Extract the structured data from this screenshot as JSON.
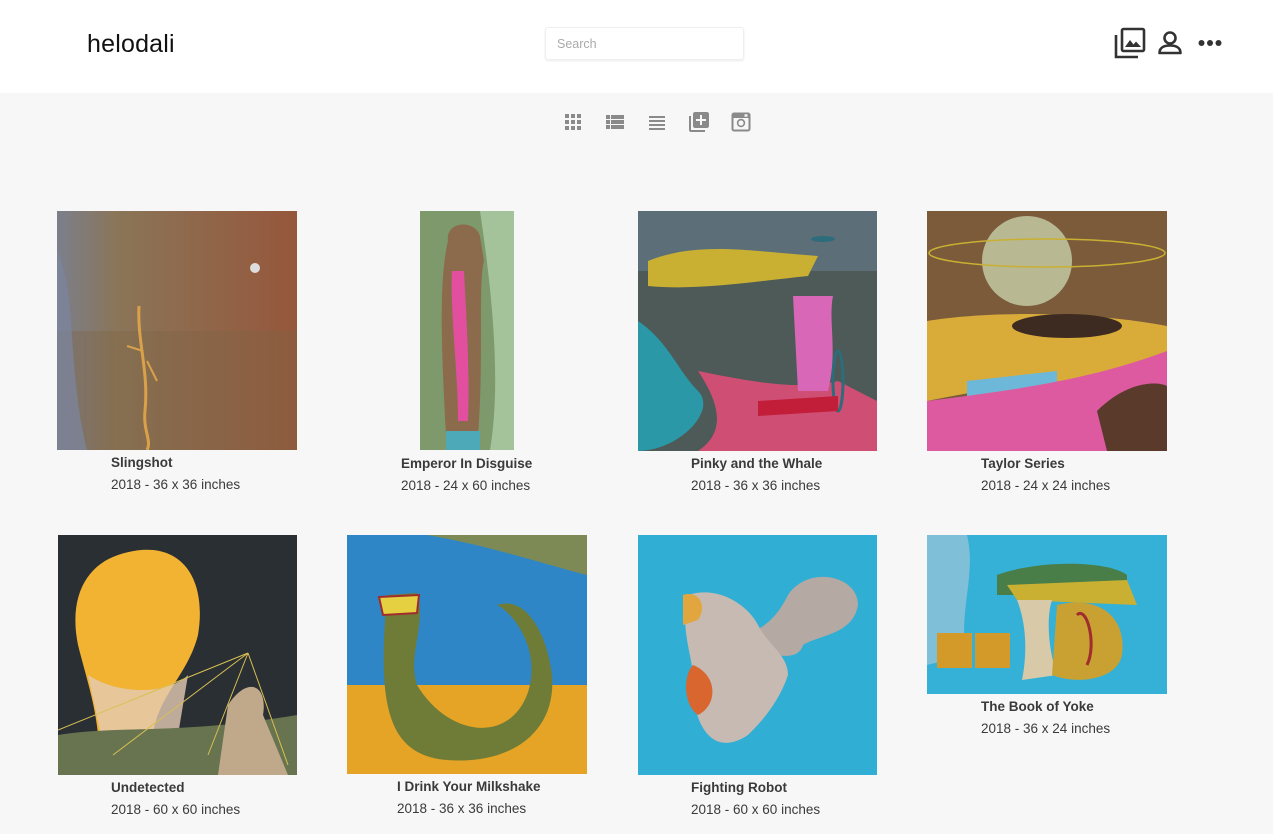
{
  "header": {
    "brand": "helodali",
    "search_placeholder": "Search",
    "icons": [
      "gallery-icon",
      "person-icon",
      "more-icon"
    ]
  },
  "view_modes": [
    "grid-view-icon",
    "list-view-icon",
    "compact-list-icon",
    "add-artwork-icon",
    "instagram-icon"
  ],
  "artworks": [
    {
      "title": "Slingshot",
      "meta": "2018 - 36 x 36 inches"
    },
    {
      "title": "Emperor In Disguise",
      "meta": "2018 - 24 x 60 inches"
    },
    {
      "title": "Pinky and the Whale",
      "meta": "2018 - 36 x 36 inches"
    },
    {
      "title": "Taylor Series",
      "meta": "2018 - 24 x 24 inches"
    },
    {
      "title": "Undetected",
      "meta": "2018 - 60 x 60 inches"
    },
    {
      "title": "I Drink Your Milkshake",
      "meta": "2018 - 36 x 36 inches"
    },
    {
      "title": "Fighting Robot",
      "meta": "2018 - 60 x 60 inches"
    },
    {
      "title": "The Book of Yoke",
      "meta": "2018 - 36 x 24 inches"
    }
  ]
}
